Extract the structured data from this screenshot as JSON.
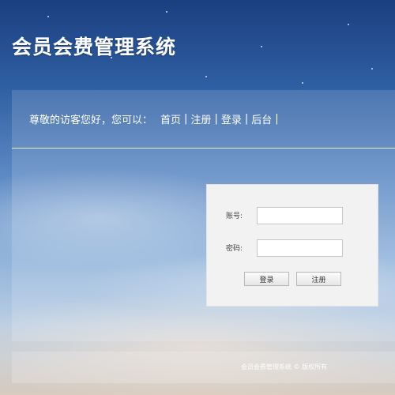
{
  "site": {
    "title": "会员会费管理系统"
  },
  "nav": {
    "greeting": "尊敬的访客您好，您可以：",
    "links": [
      "首页",
      "注册",
      "登录",
      "后台"
    ],
    "separator": "|"
  },
  "login_form": {
    "account_label": "账号:",
    "account_value": "",
    "password_label": "密码:",
    "password_value": "",
    "login_button": "登录",
    "register_button": "注册"
  },
  "footer": {
    "copyright": "会员会费管理系统 © 版权所有"
  },
  "theme": {
    "panel_color": "#ffffff",
    "form_background": "#f2f2f2"
  }
}
